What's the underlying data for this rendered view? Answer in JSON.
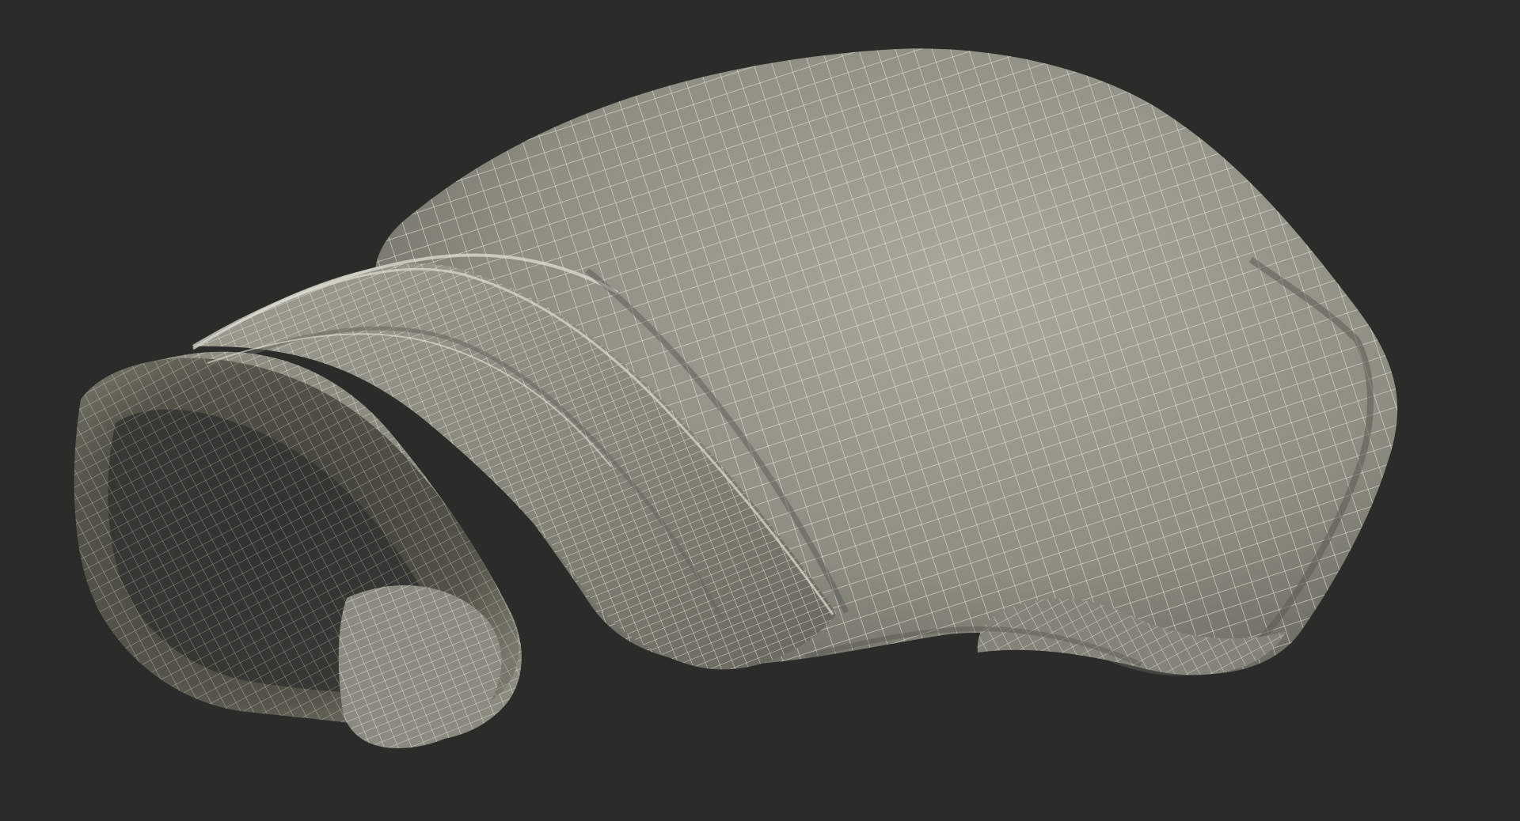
{
  "scene": {
    "subject": "boxing-glove",
    "render_style": "wireframe",
    "colors": {
      "background": "#2b2b2a",
      "surface": "#8f8f84",
      "surface_light": "#a9a99d",
      "surface_shadow": "#5f5f57",
      "inner_shadow": "#3d3d39",
      "wire": "#efeee2"
    }
  }
}
